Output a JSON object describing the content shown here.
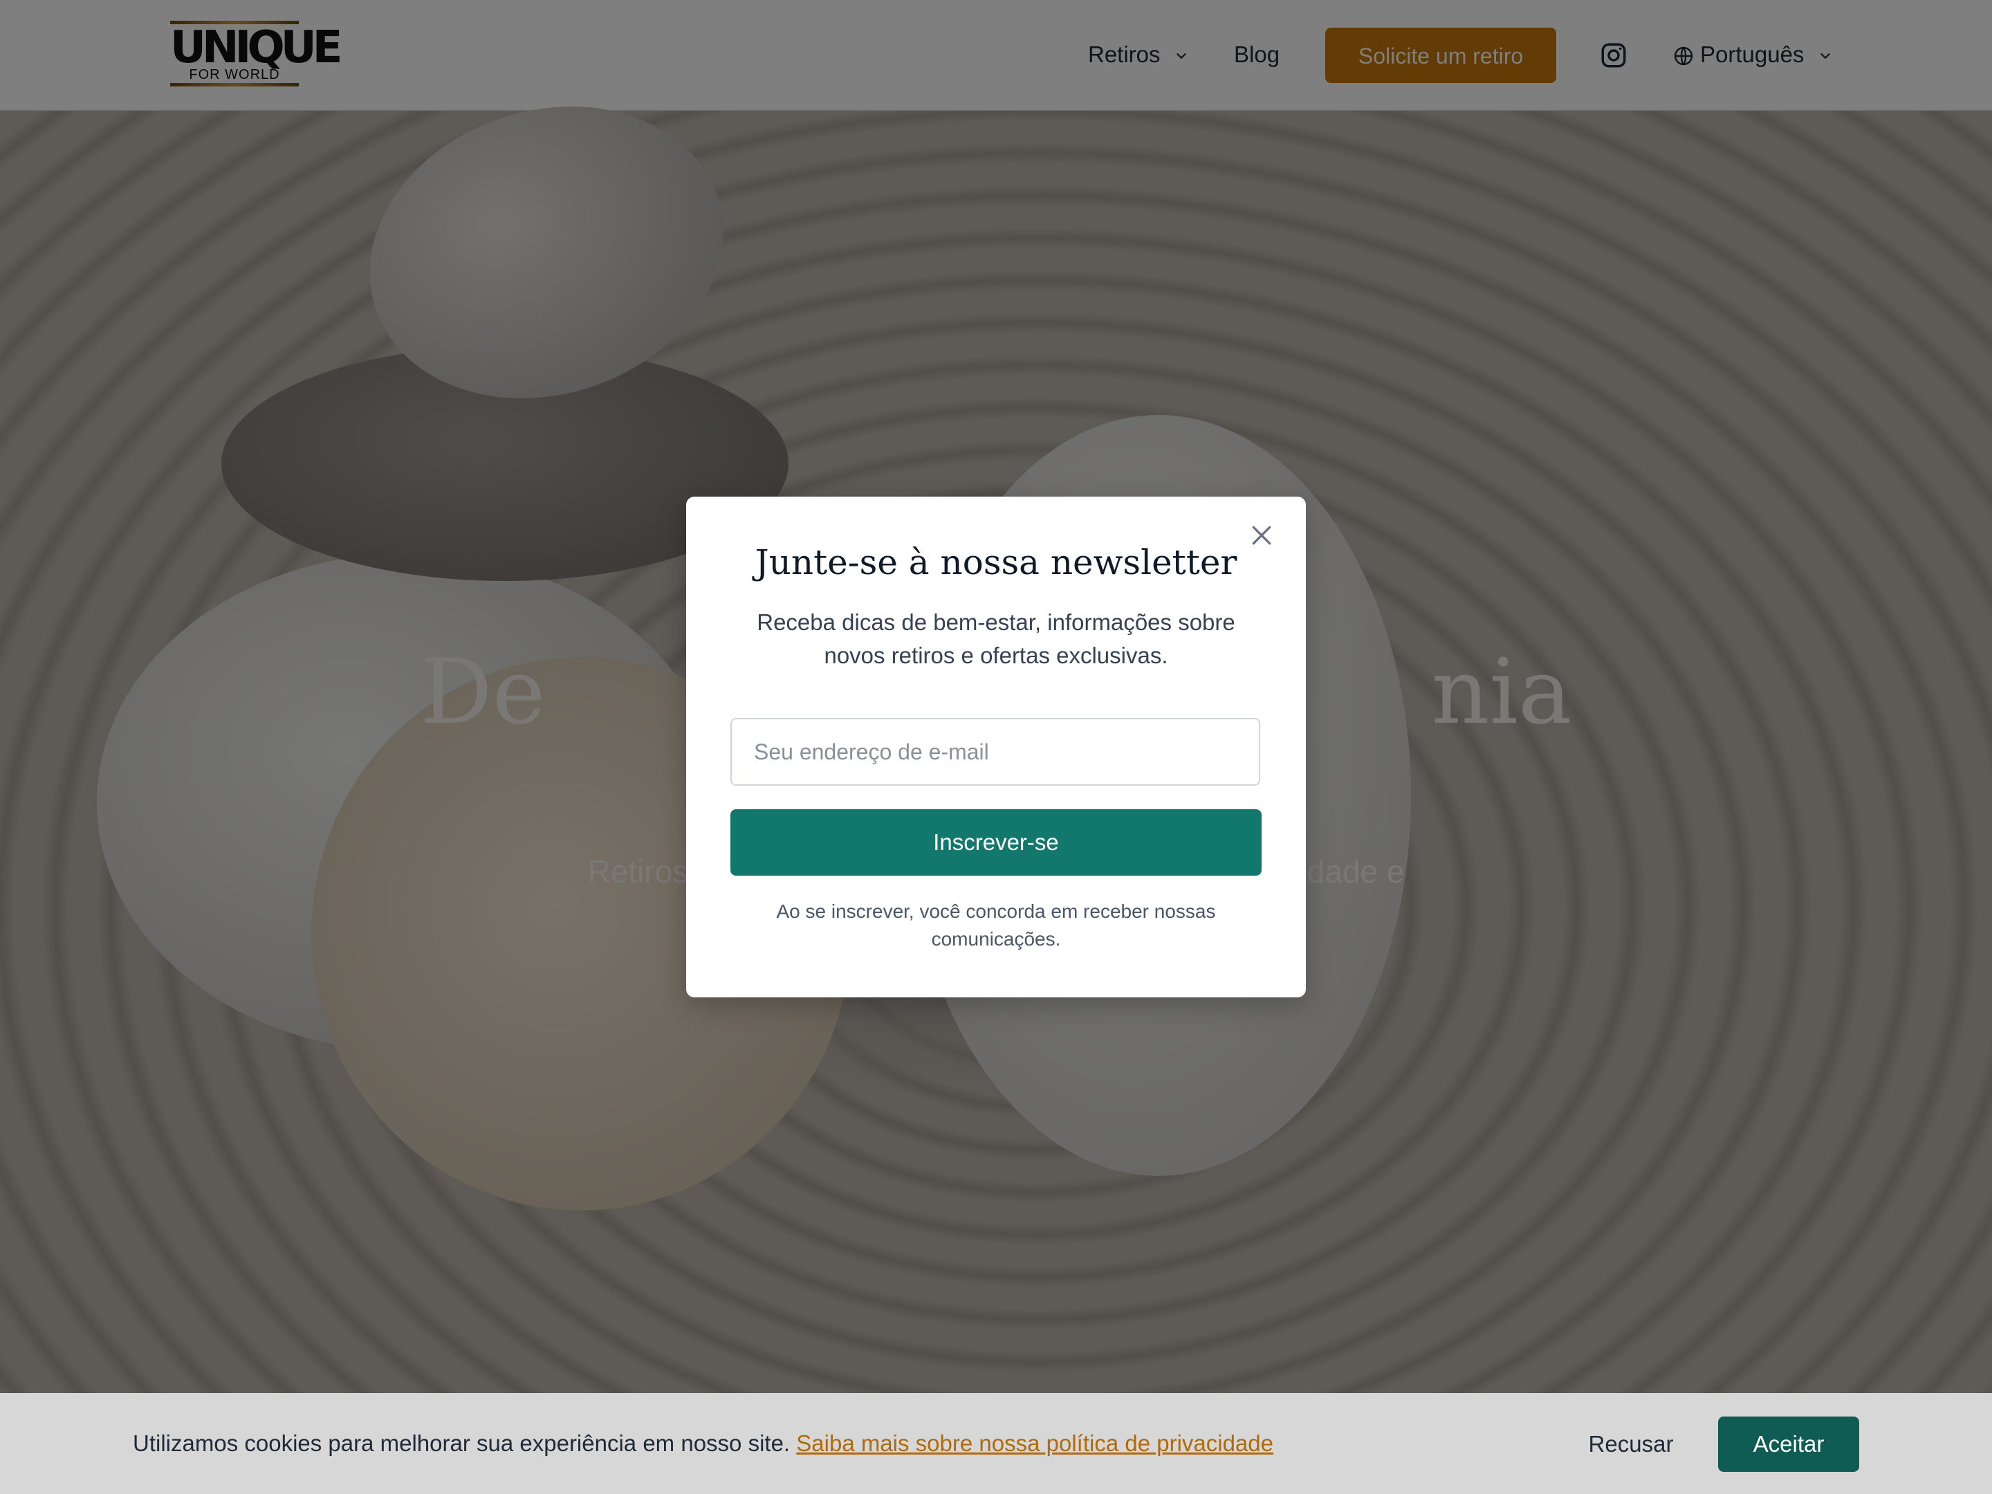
{
  "header": {
    "logo_text": "UNIQUE",
    "logo_subtext": "FOR WORLD",
    "nav": {
      "retiros": "Retiros",
      "blog": "Blog"
    },
    "cta_label": "Solicite um retiro",
    "language": "Português"
  },
  "hero": {
    "title_visible": "De                               nia",
    "subtitle_visible": "Retiros                                                                      dade e"
  },
  "modal": {
    "title": "Junte-se à nossa newsletter",
    "description": "Receba dicas de bem-estar, informações sobre novos retiros e ofertas exclusivas.",
    "email_placeholder": "Seu endereço de e-mail",
    "subscribe_label": "Inscrever-se",
    "disclaimer": "Ao se inscrever, você concorda em receber nossas comunicações."
  },
  "cookie": {
    "text": "Utilizamos cookies para melhorar sua experiência em nosso site.",
    "link": "Saiba mais sobre nossa política de privacidade",
    "decline": "Recusar",
    "accept": "Aceitar"
  },
  "colors": {
    "accent_orange": "#c77708",
    "teal": "#12786e",
    "dark_teal": "#0f5c55"
  },
  "icons": [
    "chevron-down-icon",
    "instagram-icon",
    "globe-icon",
    "close-icon"
  ]
}
